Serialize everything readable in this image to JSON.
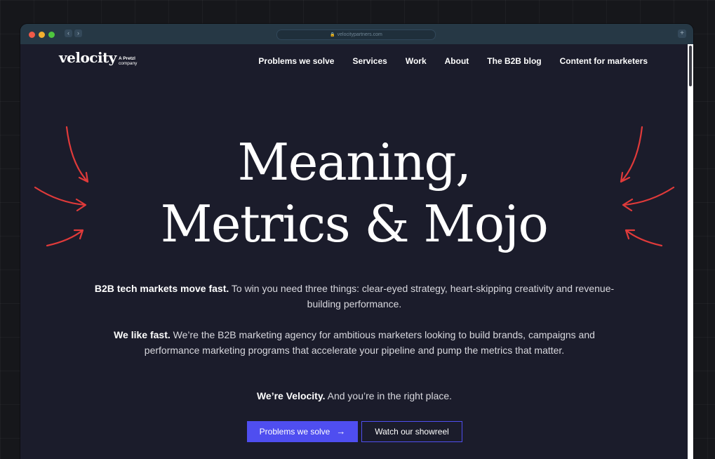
{
  "browser": {
    "url": "velocitypartners.com",
    "nav_back": "‹",
    "nav_forward": "›",
    "new_tab": "+"
  },
  "header": {
    "logo": "velocity",
    "logo_sub_line1": "A Pretzl",
    "logo_sub_line2": "company",
    "nav": [
      "Problems we solve",
      "Services",
      "Work",
      "About",
      "The B2B blog",
      "Content for marketers"
    ]
  },
  "hero": {
    "title_line1": "Meaning,",
    "title_line2": "Metrics & Mojo",
    "p1_bold": "B2B tech markets move fast.",
    "p1_rest": " To win you need three things: clear-eyed strategy, heart-skipping creativity and revenue-building performance.",
    "p2_bold": "We like fast.",
    "p2_rest": " We’re the B2B marketing agency for ambitious marketers looking to build brands, campaigns and performance marketing programs that accelerate your pipeline and pump the metrics that matter.",
    "p3_bold": "We’re Velocity.",
    "p3_rest": " And you’re in the right place.",
    "cta_primary": "Problems we solve",
    "cta_primary_arrow": "→",
    "cta_secondary": "Watch our showreel"
  },
  "colors": {
    "background": "#1b1c2b",
    "accent": "#4f4ef0",
    "arrow_red": "#e03a3a",
    "titlebar": "#263845"
  },
  "icons": [
    "lock-icon",
    "arrow-right-icon",
    "decorative-arrows-left",
    "decorative-arrows-right"
  ]
}
